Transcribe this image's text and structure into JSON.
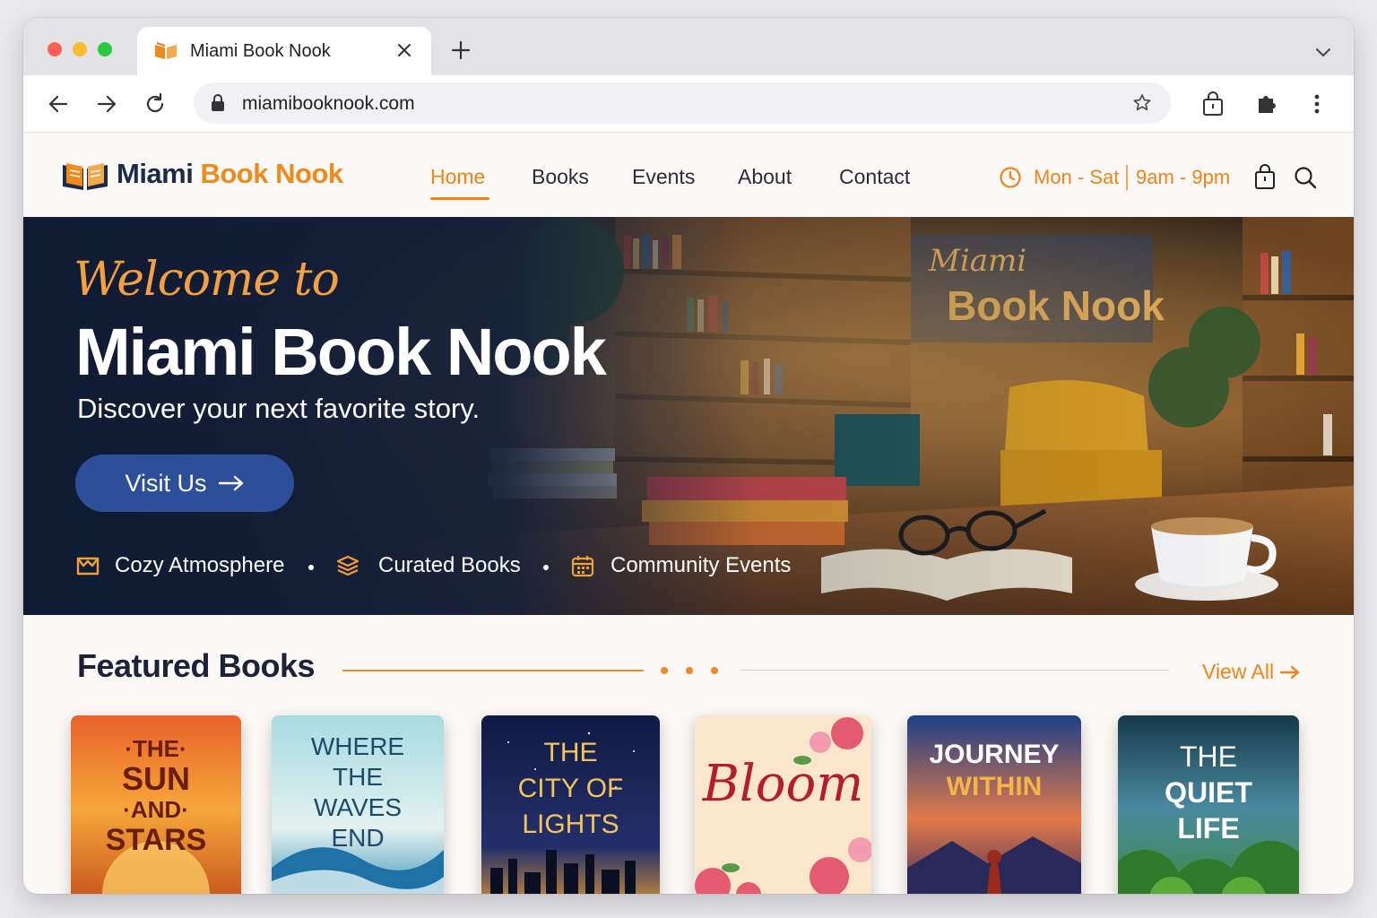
{
  "browser": {
    "tab_title": "Miami Book Nook",
    "url": "miamibooknook.com"
  },
  "site": {
    "logo_part1": "Miami",
    "logo_part2": "Book Nook",
    "nav": [
      "Home",
      "Books",
      "Events",
      "About",
      "Contact"
    ],
    "active_nav": "Home",
    "hours_days": "Mon - Sat",
    "hours_time": "9am - 9pm"
  },
  "hero": {
    "welcome": "Welcome to",
    "title": "Miami Book Nook",
    "subtitle": "Discover your next favorite story.",
    "button": "Visit Us",
    "features": [
      "Cozy Atmosphere",
      "Curated Books",
      "Community Events"
    ]
  },
  "featured": {
    "title": "Featured Books",
    "view_all": "View All",
    "books": [
      {
        "lines": [
          "·THE·",
          "SUN",
          "·AND·",
          "STARS"
        ]
      },
      {
        "lines": [
          "WHERE",
          "THE",
          "WAVES",
          "END"
        ]
      },
      {
        "lines": [
          "THE",
          "CITY OF",
          "LIGHTS"
        ]
      },
      {
        "lines": [
          "Bloom"
        ]
      },
      {
        "lines": [
          "JOURNEY",
          "WITHIN"
        ]
      },
      {
        "lines": [
          "THE",
          "QUIET",
          "LIFE"
        ]
      }
    ]
  },
  "colors": {
    "accent": "#f0841a",
    "navy": "#1c2b4a",
    "button": "#2d4f9a"
  }
}
